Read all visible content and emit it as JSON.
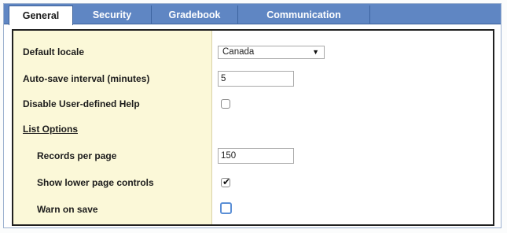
{
  "tabs": [
    {
      "label": "General",
      "active": true
    },
    {
      "label": "Security",
      "active": false
    },
    {
      "label": "Gradebook",
      "active": false
    },
    {
      "label": "Communication",
      "active": false
    }
  ],
  "settings": {
    "default_locale": {
      "label": "Default locale",
      "value": "Canada"
    },
    "autosave": {
      "label": "Auto-save interval (minutes)",
      "value": "5"
    },
    "disable_help": {
      "label": "Disable User-defined Help",
      "checked": false
    },
    "list_options": {
      "label": "List Options"
    },
    "records_per_page": {
      "label": "Records per page",
      "value": "150"
    },
    "show_lower_controls": {
      "label": "Show lower page controls",
      "checked": true
    },
    "warn_on_save": {
      "label": "Warn on save",
      "checked": false
    }
  },
  "icons": {
    "dropdown": "chevron-down-icon"
  },
  "colors": {
    "tab_bar": "#5f86c3",
    "label_column": "#fbf8d8",
    "focus": "#5b8fd6"
  }
}
